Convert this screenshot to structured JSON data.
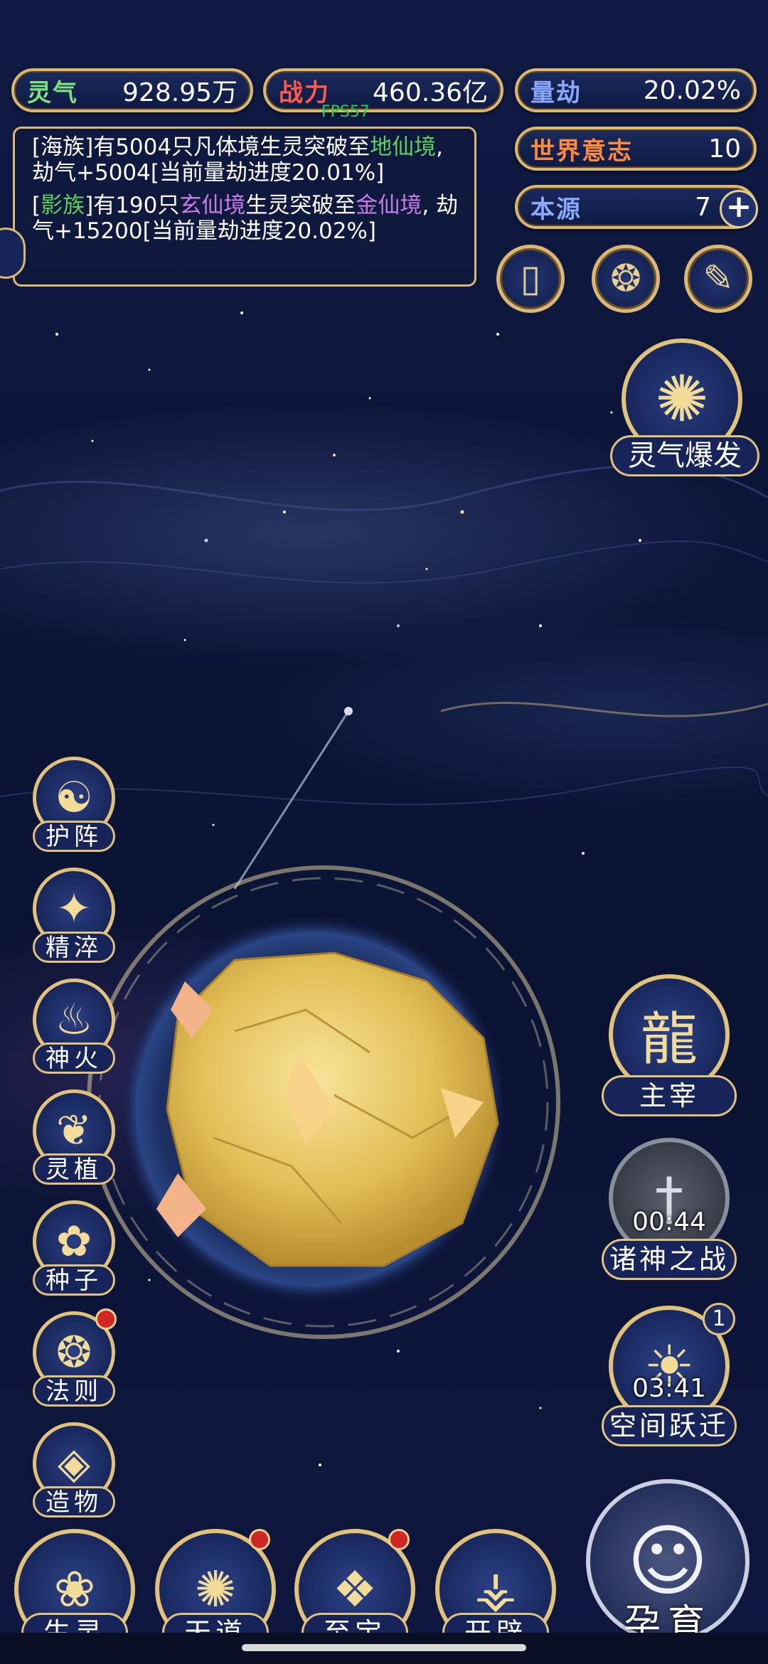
{
  "fps": "FPS57",
  "stats": {
    "lingqi": {
      "label": "灵气",
      "value": "928.95万",
      "color": "#7ee27a"
    },
    "zhanli": {
      "label": "战力",
      "value": "460.36亿",
      "color": "#ff5a4a"
    },
    "liangjie": {
      "label": "量劫",
      "value": "20.02%",
      "color": "#8aa8ff"
    },
    "world_will": {
      "label": "世界意志",
      "value": "10",
      "color": "#ff8a3a"
    },
    "benyuan": {
      "label": "本源",
      "value": "7",
      "color": "#8aa8ff",
      "plus": "+"
    }
  },
  "log": {
    "line1": {
      "p1": "[海族]有5004只凡体境生灵突破至",
      "hl": "地仙境",
      "p2": ", 劫气+5004[当前量劫进度20.01%]"
    },
    "line2": {
      "p0": "[",
      "tribe": "影族",
      "p1": "]有190只",
      "hl1": "玄仙境",
      "p2": "生灵突破至",
      "hl2": "金仙境",
      "p3": ", 劫气+15200[当前量劫进度20.02%]"
    }
  },
  "top_icons": [
    "cards-icon",
    "swirl-portal-icon",
    "scroll-icon"
  ],
  "lingqi_burst": {
    "label": "灵气爆发"
  },
  "left_skills": [
    {
      "name": "skill-huzhen",
      "label": "护阵",
      "icon": "☯",
      "dot": false
    },
    {
      "name": "skill-jingcui",
      "label": "精淬",
      "icon": "✦",
      "dot": false
    },
    {
      "name": "skill-shenhuo",
      "label": "神火",
      "icon": "♨",
      "dot": false
    },
    {
      "name": "skill-lingzhi",
      "label": "灵植",
      "icon": "❦",
      "dot": false
    },
    {
      "name": "skill-zhongzi",
      "label": "种子",
      "icon": "✿",
      "dot": false
    },
    {
      "name": "skill-faze",
      "label": "法则",
      "icon": "❂",
      "dot": true
    },
    {
      "name": "skill-zaowu",
      "label": "造物",
      "icon": "◈",
      "dot": false
    }
  ],
  "right": {
    "zhuzai": {
      "label": "主宰"
    },
    "zhushen": {
      "label": "诸神之战",
      "timer": "00:44"
    },
    "kongjian": {
      "label": "空间跃迁",
      "timer": "03:41",
      "badge": "1"
    },
    "yunyu": {
      "label": "孕育"
    }
  },
  "bottom": [
    {
      "label": "生灵",
      "dot": false
    },
    {
      "label": "天道",
      "dot": true
    },
    {
      "label": "至宝",
      "dot": true
    },
    {
      "label": "开辟",
      "dot": false
    }
  ]
}
